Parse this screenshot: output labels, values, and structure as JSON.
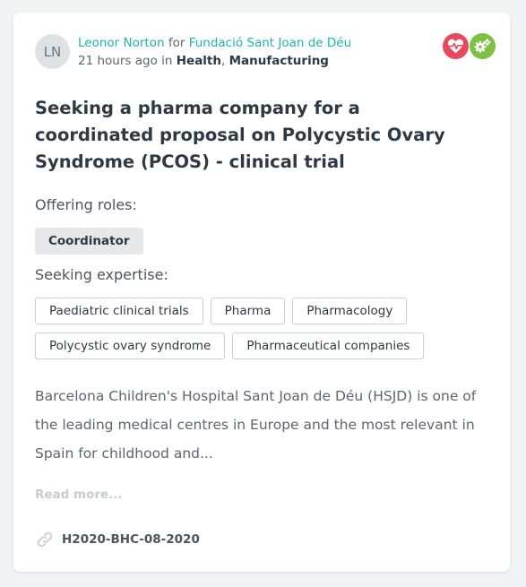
{
  "author": {
    "initials": "LN",
    "name": "Leonor Norton",
    "connector": "for",
    "organization": "Fundació Sant Joan de Déu",
    "time": "21 hours ago",
    "time_connector": "in",
    "categories": [
      "Health",
      "Manufacturing"
    ],
    "separator": ","
  },
  "badges": [
    {
      "icon": "heart-pulse-icon",
      "color": "#e8475c"
    },
    {
      "icon": "gears-icon",
      "color": "#7cc242"
    }
  ],
  "title": "Seeking a pharma company for a coordinated proposal on Polycystic Ovary Syndrome (PCOS) - clinical trial",
  "offering": {
    "label": "Offering roles:",
    "roles": [
      "Coordinator"
    ]
  },
  "seeking": {
    "label": "Seeking expertise:",
    "tags_row1": [
      "Paediatric clinical trials",
      "Pharma",
      "Pharmacology"
    ],
    "tags_row2": [
      "Polycystic ovary syndrome",
      "Pharmaceutical companies"
    ]
  },
  "description": "Barcelona Children's Hospital Sant Joan de Déu (HSJD) is one of the leading medical centres in Europe and the most relevant in Spain for childhood and...",
  "read_more": "Read more...",
  "call": {
    "icon": "link-icon",
    "id": "H2020-BHC-08-2020"
  }
}
